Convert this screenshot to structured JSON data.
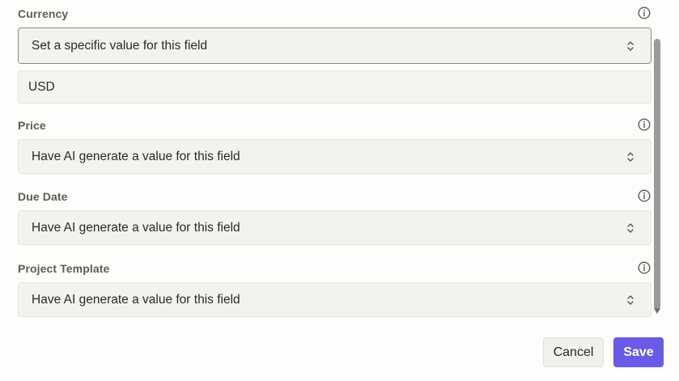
{
  "fields": {
    "currency": {
      "label": "Currency",
      "mode": "Set a specific value for this field",
      "value": "USD"
    },
    "price": {
      "label": "Price",
      "mode": "Have AI generate a value for this field"
    },
    "due_date": {
      "label": "Due Date",
      "mode": "Have AI generate a value for this field"
    },
    "project_template": {
      "label": "Project Template",
      "mode": "Have AI generate a value for this field"
    }
  },
  "actions": {
    "cancel_label": "Cancel",
    "save_label": "Save"
  },
  "icons": {
    "info": "info-circle-icon",
    "select": "chevron-up-down-icon"
  },
  "colors": {
    "accent": "#6a5ae8",
    "field_bg": "#f3f2ec",
    "label": "#5f5c55"
  }
}
